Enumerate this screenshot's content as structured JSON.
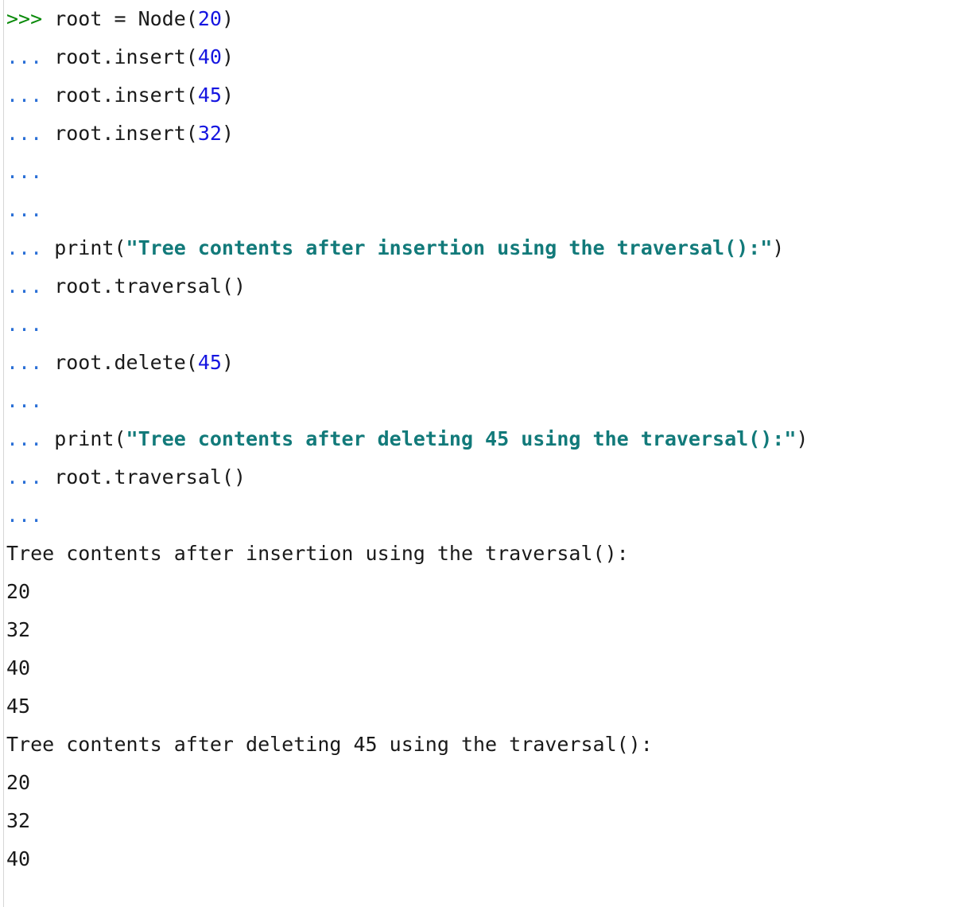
{
  "prompts": {
    "primary": ">>>",
    "continuation": "..."
  },
  "code_lines": {
    "l1": {
      "code": " root = Node(",
      "arg": "20",
      "close": ")"
    },
    "l2": {
      "code": " root.insert(",
      "arg": "40",
      "close": ")"
    },
    "l3": {
      "code": " root.insert(",
      "arg": "45",
      "close": ")"
    },
    "l4": {
      "code": " root.insert(",
      "arg": "32",
      "close": ")"
    },
    "l7": {
      "code": " print(",
      "string": "\"Tree contents after insertion using the traversal():\"",
      "close": ")"
    },
    "l8": {
      "code": " root.traversal()"
    },
    "l10": {
      "code": " root.delete(",
      "arg": "45",
      "close": ")"
    },
    "l12": {
      "code": " print(",
      "string": "\"Tree contents after deleting 45 using the traversal():\"",
      "close": ")"
    },
    "l13": {
      "code": " root.traversal()"
    }
  },
  "output": {
    "heading1": "Tree contents after insertion using the traversal():",
    "values1": [
      "20",
      "32",
      "40",
      "45"
    ],
    "heading2": "Tree contents after deleting 45 using the traversal():",
    "values2": [
      "20",
      "32",
      "40"
    ]
  },
  "colors": {
    "prompt": "#0a8a0a",
    "continuation": "#2a6fd6",
    "number": "#1515e0",
    "string": "#127a7a",
    "text": "#1a1a1a"
  }
}
